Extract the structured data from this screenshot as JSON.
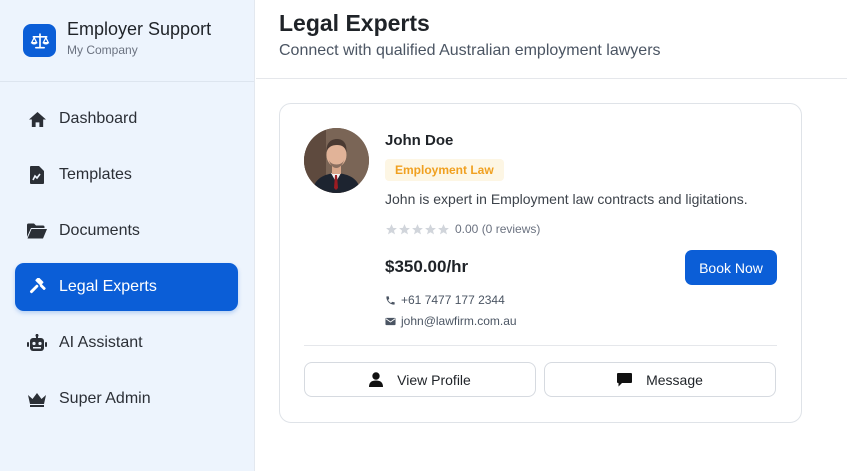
{
  "brand": {
    "title": "Employer Support",
    "subtitle": "My Company",
    "icon": "scale-icon"
  },
  "nav": {
    "items": [
      {
        "label": "Dashboard",
        "icon": "home-icon"
      },
      {
        "label": "Templates",
        "icon": "file-chart-icon"
      },
      {
        "label": "Documents",
        "icon": "folder-open-icon"
      },
      {
        "label": "Legal Experts",
        "icon": "gavel-icon",
        "active": true
      },
      {
        "label": "AI Assistant",
        "icon": "robot-icon"
      },
      {
        "label": "Super Admin",
        "icon": "crown-icon"
      }
    ]
  },
  "header": {
    "title": "Legal Experts",
    "subtitle": "Connect with qualified Australian employment lawyers"
  },
  "expert": {
    "name": "John Doe",
    "specialty": "Employment Law",
    "bio": "John is expert in Employment law contracts and ligitations.",
    "rating_text": "0.00 (0 reviews)",
    "rating_value": 0,
    "rate": "$350.00/hr",
    "book_label": "Book Now",
    "phone": "+61 7477 177 2344",
    "email": "john@lawfirm.com.au",
    "view_profile_label": "View Profile",
    "message_label": "Message"
  },
  "colors": {
    "accent": "#0b5ed7",
    "tag_text": "#f0a020",
    "tag_bg": "#fdf6e4"
  }
}
